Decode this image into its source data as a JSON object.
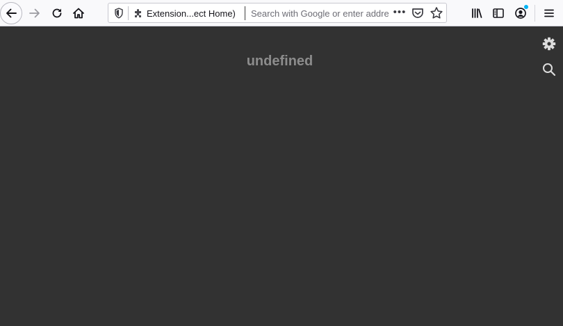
{
  "toolbar": {
    "url_label": "Extension...ect Home)",
    "search_placeholder": "Search with Google or enter address",
    "more_label": "•••"
  },
  "icons": {
    "back": "arrow-left-icon",
    "forward": "arrow-right-icon",
    "reload": "reload-icon",
    "home": "home-icon",
    "shield": "shield-icon",
    "extension": "puzzle-icon",
    "pocket": "pocket-icon",
    "bookmark": "star-icon",
    "library": "library-icon",
    "sidebar": "sidebar-icon",
    "account": "account-icon",
    "menu": "hamburger-menu-icon",
    "settings": "gear-icon",
    "search": "search-icon"
  },
  "page": {
    "title": "undefined"
  },
  "colors": {
    "toolbar_bg": "#f9f9fb",
    "content_bg": "#323232",
    "title_text": "#8c8c8c",
    "account_badge": "#00b3f4"
  }
}
